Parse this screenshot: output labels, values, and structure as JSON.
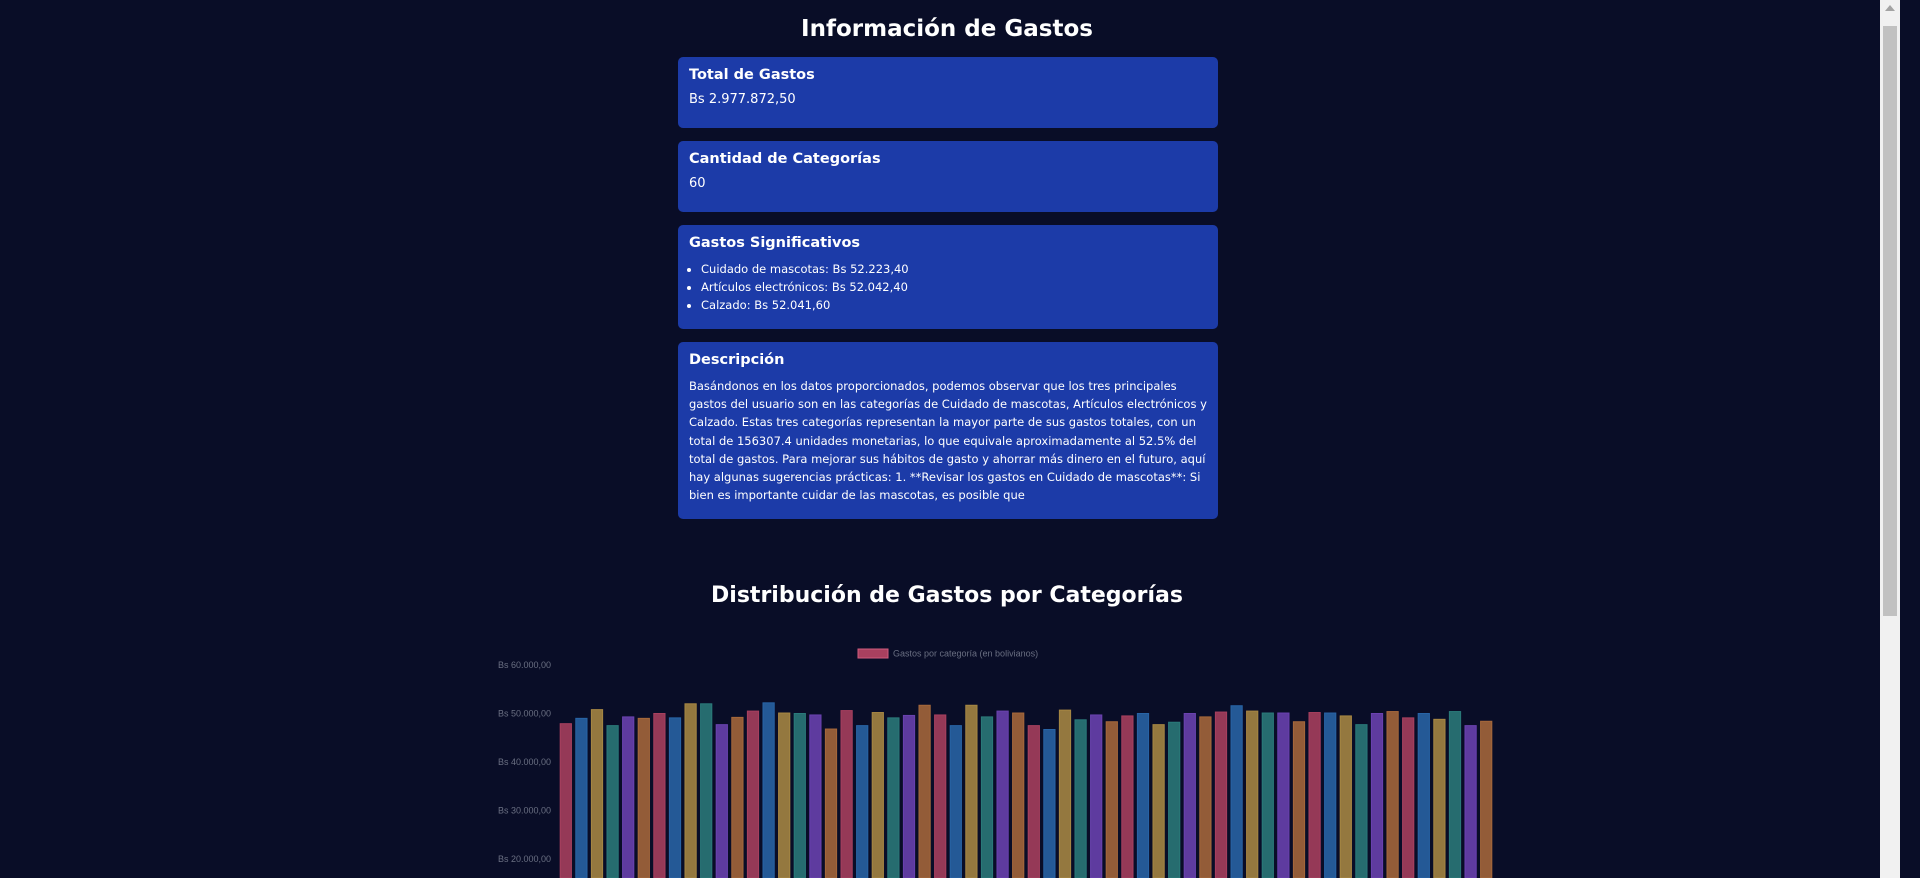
{
  "page_title": "Información de Gastos",
  "cards": {
    "total": {
      "title": "Total de Gastos",
      "value": "Bs 2.977.872,50"
    },
    "categories": {
      "title": "Cantidad de Categorías",
      "value": "60"
    },
    "significant": {
      "title": "Gastos Significativos",
      "items": [
        "Cuidado de mascotas: Bs 52.223,40",
        "Artículos electrónicos: Bs 52.042,40",
        "Calzado: Bs 52.041,60"
      ]
    },
    "description": {
      "title": "Descripción",
      "text": "Basándonos en los datos proporcionados, podemos observar que los tres principales gastos del usuario son en las categorías de Cuidado de mascotas, Artículos electrónicos y Calzado. Estas tres categorías representan la mayor parte de sus gastos totales, con un total de 156307.4 unidades monetarias, lo que equivale aproximadamente al 52.5% del total de gastos. Para mejorar sus hábitos de gasto y ahorrar más dinero en el futuro, aquí hay algunas sugerencias prácticas: 1. **Revisar los gastos en Cuidado de mascotas**: Si bien es importante cuidar de las mascotas, es posible que"
    }
  },
  "chart_title": "Distribución de Gastos por Categorías",
  "colors": {
    "background": "#090d27",
    "card": "#1c3ba8",
    "series_palette": [
      "#a8405f",
      "#2864a6",
      "#a78743",
      "#2a7a7a",
      "#6a42b0",
      "#a6683b"
    ]
  },
  "chart_data": {
    "type": "bar",
    "title": "",
    "legend": {
      "label": "Gastos por categoría (en bolivianos)",
      "position": "top",
      "color": "#a8405f"
    },
    "y_ticks": [
      "Bs 20.000,00",
      "Bs 30.000,00",
      "Bs 40.000,00",
      "Bs 50.000,00",
      "Bs 60.000,00"
    ],
    "ylim": [
      20000,
      60000
    ],
    "categories": [],
    "series": [
      {
        "values": [
          47900,
          49000,
          50800,
          47500,
          49300,
          49000,
          50000,
          49100,
          52000,
          52000,
          47700,
          49200,
          50500,
          52200,
          50100,
          50000,
          49700,
          46800,
          50600,
          47500,
          50200,
          49100,
          49600,
          51700,
          49700,
          47500,
          51700,
          49300,
          50500,
          50100,
          47500,
          46700,
          50700,
          48700,
          49700,
          48300,
          49500,
          50000,
          47700,
          48200,
          50000,
          49300,
          50300,
          51600,
          50500,
          50100,
          50100,
          48300,
          50200,
          50100,
          49500,
          47700,
          50000,
          50400,
          49100,
          50000,
          48800,
          50400,
          47500,
          48400
        ]
      }
    ]
  }
}
